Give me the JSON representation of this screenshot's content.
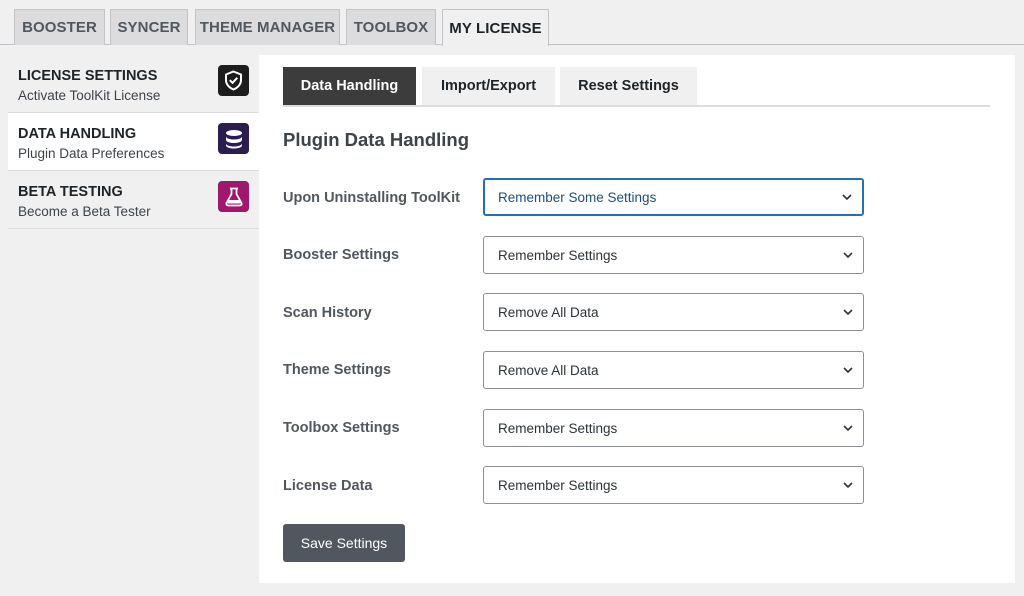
{
  "top_tabs": [
    "BOOSTER",
    "SYNCER",
    "THEME MANAGER",
    "TOOLBOX",
    "MY LICENSE"
  ],
  "top_tab_active": "MY LICENSE",
  "sidebar": {
    "items": [
      {
        "title": "LICENSE SETTINGS",
        "subtitle": "Activate ToolKit License",
        "icon": "shield-check-icon",
        "icon_color": "#1d1d1d"
      },
      {
        "title": "DATA HANDLING",
        "subtitle": "Plugin Data Preferences",
        "icon": "database-icon",
        "icon_color": "#2b1d4f"
      },
      {
        "title": "BETA TESTING",
        "subtitle": "Become a Beta Tester",
        "icon": "flask-icon",
        "icon_color": "#a0186b"
      }
    ],
    "active": "DATA HANDLING"
  },
  "sub_tabs": [
    "Data Handling",
    "Import/Export",
    "Reset Settings"
  ],
  "sub_tab_active": "Data Handling",
  "section_title": "Plugin Data Handling",
  "settings": [
    {
      "label": "Upon Uninstalling ToolKit",
      "value": "Remember Some Settings",
      "focused": true
    },
    {
      "label": "Booster Settings",
      "value": "Remember Settings"
    },
    {
      "label": "Scan History",
      "value": "Remove All Data"
    },
    {
      "label": "Theme Settings",
      "value": "Remove All Data"
    },
    {
      "label": "Toolbox Settings",
      "value": "Remember Settings"
    },
    {
      "label": "License Data",
      "value": "Remember Settings"
    }
  ],
  "save_label": "Save Settings",
  "colors": {
    "accent": "#2271b1",
    "active_tab": "#3c3c3c",
    "button": "#50575e"
  }
}
